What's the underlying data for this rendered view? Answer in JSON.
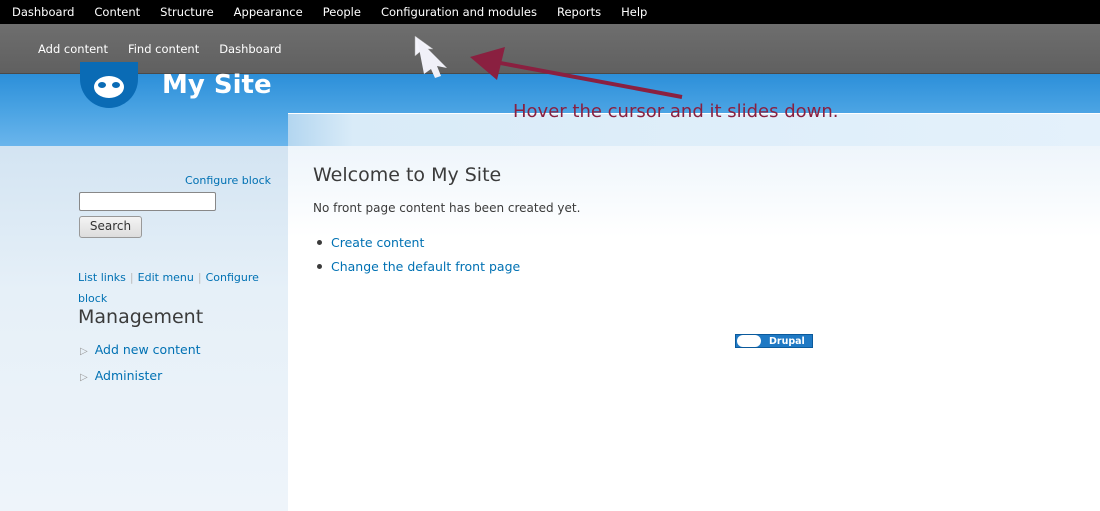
{
  "admin_menu": {
    "items": [
      "Dashboard",
      "Content",
      "Structure",
      "Appearance",
      "People",
      "Configuration and modules",
      "Reports",
      "Help"
    ]
  },
  "shortcuts": {
    "items": [
      "Add content",
      "Find content",
      "Dashboard"
    ]
  },
  "header": {
    "site_name": "My Site"
  },
  "sidebar": {
    "search_block": {
      "configure_label": "Configure block",
      "search_value": "",
      "search_button": "Search"
    },
    "management_block": {
      "links": [
        "List links",
        "Edit menu",
        "Configure block"
      ],
      "title": "Management",
      "items": [
        "Add new content",
        "Administer"
      ]
    }
  },
  "main": {
    "title": "Welcome to My Site",
    "message": "No front page content has been created yet.",
    "links": [
      "Create content",
      "Change the default front page"
    ]
  },
  "footer": {
    "badge_text": "Drupal"
  },
  "annotation": {
    "text": "Hover the cursor and it slides down."
  },
  "colors": {
    "link": "#0071b3",
    "header_blue": "#2c8fd9",
    "annotation": "#8a2040"
  }
}
